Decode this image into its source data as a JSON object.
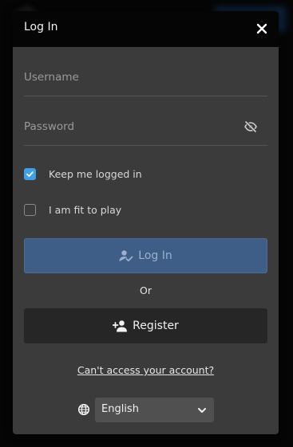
{
  "dialog": {
    "title": "Log In",
    "close_icon": "close-icon"
  },
  "form": {
    "username_placeholder": "Username",
    "username_value": "",
    "password_placeholder": "Password",
    "password_value": "",
    "password_toggle_icon": "eye-off-icon",
    "keep_logged_in_label": "Keep me logged in",
    "keep_logged_in_checked": true,
    "fit_to_play_label": "I am fit to play",
    "fit_to_play_checked": false
  },
  "buttons": {
    "login_label": "Log In",
    "login_icon": "user-check-icon",
    "or_text": "Or",
    "register_label": "Register",
    "register_icon": "user-plus-icon"
  },
  "links": {
    "forgot_account": "Can't access your account?"
  },
  "language": {
    "icon": "globe-icon",
    "selected": "English"
  },
  "colors": {
    "modal_bg": "#3b3b3b",
    "header_bg": "#050505",
    "checkbox_accent": "#3ea0e8",
    "login_button_bg": "#3f5e87",
    "register_button_bg": "#262626",
    "language_select_bg": "#505050"
  }
}
